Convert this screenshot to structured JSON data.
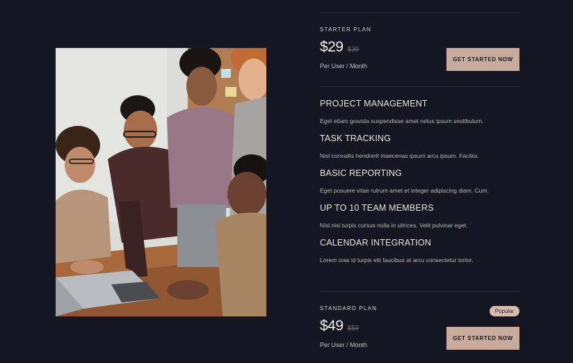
{
  "starter": {
    "name": "STARTER PLAN",
    "price": "$29",
    "old_price": "$39",
    "per": "Per User / Month",
    "cta": "GET STARTED NOW"
  },
  "features": [
    {
      "title": "PROJECT MANAGEMENT",
      "desc": "Eget etiam gravida suspendisse amet netus ipsum vestibulum."
    },
    {
      "title": "TASK TRACKING",
      "desc": "Nisl convallis hendrerit maecenas ipsum arcu ipsum. Facilisi."
    },
    {
      "title": "BASIC REPORTING",
      "desc": "Eget posuere vitae rutrum amet et integer adipiscing diam. Cum."
    },
    {
      "title": "UP TO 10 TEAM MEMBERS",
      "desc": "Nisl nisi turpis cursus nulla in ultrices. Velit pulvinar eget."
    },
    {
      "title": "CALENDAR INTEGRATION",
      "desc": "Lorem cras id turpis elit faucibus at arcu consectetur tortor."
    }
  ],
  "standard": {
    "name": "STANDARD PLAN",
    "badge": "Popular",
    "price": "$49",
    "old_price": "$59",
    "per": "Per User / Month",
    "cta": "GET STARTED NOW"
  },
  "colors": {
    "background": "#161622",
    "accent": "#c9ab9d",
    "badge": "#d6bdb0"
  }
}
